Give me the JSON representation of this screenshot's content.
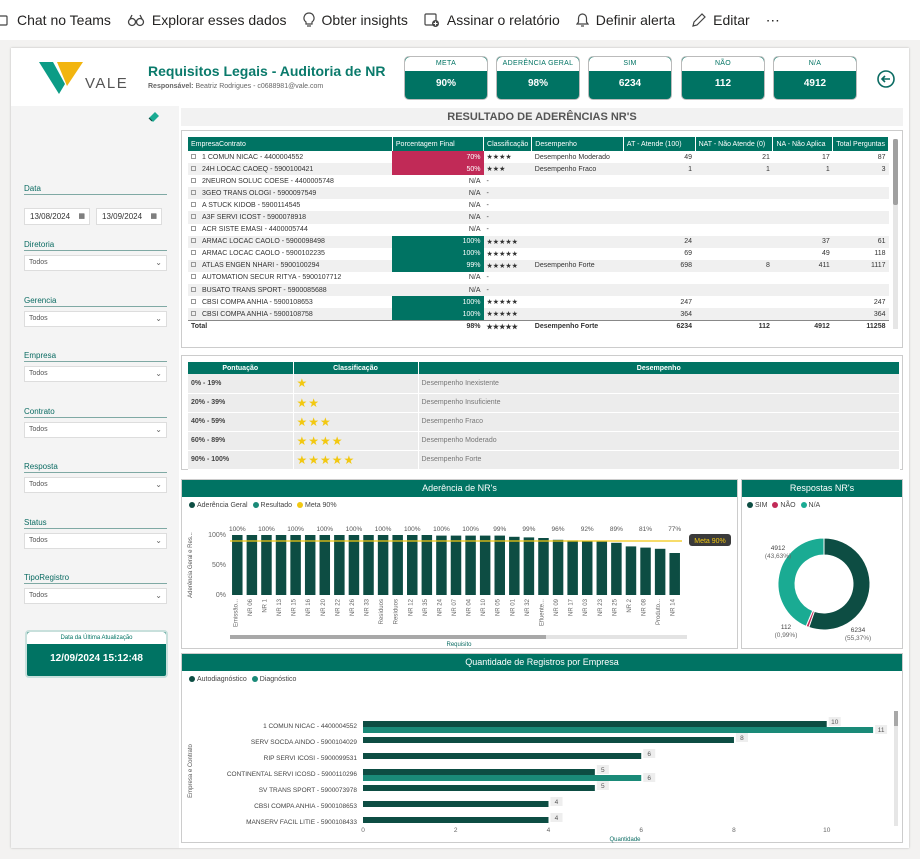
{
  "toolbar": {
    "chat_teams": "Chat no Teams",
    "explore": "Explorar esses dados",
    "insights": "Obter insights",
    "subscribe": "Assinar o relatório",
    "alert": "Definir alerta",
    "edit": "Editar",
    "more": "⋯"
  },
  "header": {
    "logo_text": "VALE",
    "title": "Requisitos Legais - Auditoria de NR",
    "responsible_label": "Responsável:",
    "responsible_value": "Beatriz Rodrigues - c0688981@vale.com"
  },
  "kpis": [
    {
      "label": "META",
      "value": "90%"
    },
    {
      "label": "ADERÊNCIA GERAL",
      "value": "98%"
    },
    {
      "label": "SIM",
      "value": "6234"
    },
    {
      "label": "NÃO",
      "value": "112"
    },
    {
      "label": "N/A",
      "value": "4912"
    }
  ],
  "filters": {
    "data_label": "Data",
    "date_from": "13/08/2024",
    "date_to": "13/09/2024",
    "items": [
      {
        "label": "Diretoria",
        "value": "Todos"
      },
      {
        "label": "Gerencia",
        "value": "Todos"
      },
      {
        "label": "Empresa",
        "value": "Todos"
      },
      {
        "label": "Contrato",
        "value": "Todos"
      },
      {
        "label": "Resposta",
        "value": "Todos"
      },
      {
        "label": "Status",
        "value": "Todos"
      },
      {
        "label": "TipoRegistro",
        "value": "Todos"
      }
    ],
    "update_label": "Data da Última Atualização",
    "update_value": "12/09/2024 15:12:48"
  },
  "section_title": "RESULTADO DE ADERÊNCIAS NR'S",
  "main_table": {
    "headers": [
      "EmpresaContrato",
      "Porcentagem Final",
      "Classificação",
      "Desempenho",
      "AT - Atende (100)",
      "NAT - Não Atende (0)",
      "NA - Não Aplica",
      "Total Perguntas"
    ],
    "rows": [
      {
        "name": "1 COMUN NICAC - 4400004552",
        "pct": "70%",
        "pct_color": "red",
        "stars": "★★★★",
        "desemp": "Desempenho Moderado",
        "at": "49",
        "nat": "21",
        "na": "17",
        "total": "87"
      },
      {
        "name": "24H LOCAC CAOEQ - 5900100421",
        "pct": "50%",
        "pct_color": "red",
        "stars": "★★★",
        "desemp": "Desempenho Fraco",
        "at": "1",
        "nat": "1",
        "na": "1",
        "total": "3"
      },
      {
        "name": "2NEURON SOLUC COESE - 4400005748",
        "pct": "N/A",
        "pct_color": "",
        "stars": "-",
        "desemp": "",
        "at": "",
        "nat": "",
        "na": "",
        "total": ""
      },
      {
        "name": "3GEO TRANS OLOGI - 5900097549",
        "pct": "N/A",
        "pct_color": "",
        "stars": "-",
        "desemp": "",
        "at": "",
        "nat": "",
        "na": "",
        "total": ""
      },
      {
        "name": "A STUCK KIDOB - 5900114545",
        "pct": "N/A",
        "pct_color": "",
        "stars": "-",
        "desemp": "",
        "at": "",
        "nat": "",
        "na": "",
        "total": ""
      },
      {
        "name": "A3F SERVI ICOST - 5900078918",
        "pct": "N/A",
        "pct_color": "",
        "stars": "-",
        "desemp": "",
        "at": "",
        "nat": "",
        "na": "",
        "total": ""
      },
      {
        "name": "ACR SISTE EMASI - 4400005744",
        "pct": "N/A",
        "pct_color": "",
        "stars": "-",
        "desemp": "",
        "at": "",
        "nat": "",
        "na": "",
        "total": ""
      },
      {
        "name": "ARMAC LOCAC CAOLO - 5900098498",
        "pct": "100%",
        "pct_color": "grn",
        "stars": "★★★★★",
        "desemp": "",
        "at": "24",
        "nat": "",
        "na": "37",
        "total": "61"
      },
      {
        "name": "ARMAC LOCAC CAOLO - 5900102235",
        "pct": "100%",
        "pct_color": "grn",
        "stars": "★★★★★",
        "desemp": "",
        "at": "69",
        "nat": "",
        "na": "49",
        "total": "118"
      },
      {
        "name": "ATLAS ENGEN NHARI - 5900100294",
        "pct": "99%",
        "pct_color": "grn",
        "stars": "★★★★★",
        "desemp": "Desempenho Forte",
        "at": "698",
        "nat": "8",
        "na": "411",
        "total": "1117"
      },
      {
        "name": "AUTOMATION SECUR RITYA - 5900107712",
        "pct": "N/A",
        "pct_color": "",
        "stars": "-",
        "desemp": "",
        "at": "",
        "nat": "",
        "na": "",
        "total": ""
      },
      {
        "name": "BUSATO TRANS SPORT - 5900085688",
        "pct": "N/A",
        "pct_color": "",
        "stars": "-",
        "desemp": "",
        "at": "",
        "nat": "",
        "na": "",
        "total": ""
      },
      {
        "name": "CBSI COMPA ANHIA - 5900108653",
        "pct": "100%",
        "pct_color": "grn",
        "stars": "★★★★★",
        "desemp": "",
        "at": "247",
        "nat": "",
        "na": "",
        "total": "247"
      },
      {
        "name": "CBSI COMPA ANHIA - 5900108758",
        "pct": "100%",
        "pct_color": "grn",
        "stars": "★★★★★",
        "desemp": "",
        "at": "364",
        "nat": "",
        "na": "",
        "total": "364"
      }
    ],
    "total": {
      "name": "Total",
      "pct": "98%",
      "stars": "★★★★★",
      "desemp": "Desempenho Forte",
      "at": "6234",
      "nat": "112",
      "na": "4912",
      "total": "11258"
    }
  },
  "legend_table": {
    "headers": [
      "Pontuação",
      "Classificação",
      "Desempenho"
    ],
    "rows": [
      {
        "range": "0% - 19%",
        "stars": "★",
        "desc": "Desempenho Inexistente"
      },
      {
        "range": "20% - 39%",
        "stars": "★★",
        "desc": "Desempenho Insuficiente"
      },
      {
        "range": "40% - 59%",
        "stars": "★★★",
        "desc": "Desempenho Fraco"
      },
      {
        "range": "60% - 89%",
        "stars": "★★★★",
        "desc": "Desempenho Moderado"
      },
      {
        "range": "90% - 100%",
        "stars": "★★★★★",
        "desc": "Desempenho Forte"
      }
    ]
  },
  "colors": {
    "primary": "#007363",
    "dark": "#0d4d43",
    "mid": "#1aab93",
    "red": "#c12a57",
    "gold": "#f2c811"
  },
  "chart_data": [
    {
      "type": "bar",
      "title": "Aderência de NR's",
      "xlabel": "Requisito",
      "ylabel": "Aderência Geral e Res...",
      "ylim": [
        0,
        100
      ],
      "yticks": [
        "0%",
        "50%",
        "100%"
      ],
      "legend": [
        "Aderência Geral",
        "Resultado",
        "Meta 90%"
      ],
      "meta_label": "Meta 90%",
      "meta": 90,
      "categories": [
        "Emissão...",
        "NR 06",
        "NR 1",
        "NR 13",
        "NR 15",
        "NR 16",
        "NR 20",
        "NR 22",
        "NR 26",
        "NR 33",
        "Resíduos",
        "Resíduos",
        "NR 12",
        "NR 35",
        "NR 24",
        "NR 07",
        "NR 04",
        "NR 10",
        "NR 05",
        "NR 01",
        "NR 32",
        "Efluente...",
        "NR 09",
        "NR 17",
        "NR 03",
        "NR 23",
        "NR 25",
        "NR 2",
        "NR 08",
        "Produto...",
        "NR 14"
      ],
      "values": [
        100,
        100,
        100,
        100,
        100,
        100,
        100,
        100,
        100,
        100,
        100,
        100,
        100,
        100,
        99,
        99,
        99,
        99,
        99,
        97,
        96,
        95,
        92,
        91,
        90,
        89,
        87,
        81,
        79,
        77,
        70
      ],
      "labels": [
        "100%",
        "100%",
        "100%",
        "100%",
        "100%",
        "100%",
        "100%",
        "100%",
        "100%",
        "100%",
        "100%",
        "100%",
        "100%",
        "100%",
        "99%",
        "99%",
        "99%",
        "99%",
        "96%",
        "92%",
        "89%",
        "81%",
        "77%"
      ]
    },
    {
      "type": "pie",
      "title": "Respostas NR's",
      "legend": [
        "SIM",
        "NÃO",
        "N/A"
      ],
      "values": [
        6234,
        112,
        4912
      ],
      "percent": [
        "55,37%",
        "0,99%",
        "43,63%"
      ]
    },
    {
      "type": "bar",
      "title": "Quantidade de Registros por Empresa",
      "xlabel": "Quantidade",
      "ylabel": "Empresa e Contrato",
      "legend": [
        "Autodiagnóstico",
        "Diagnóstico"
      ],
      "categories": [
        "1 COMUN NICAC - 4400004552",
        "SERV SOCDA AINDO - 5900104029",
        "RIP SERVI ICOSI - 5900099531",
        "CONTINENTAL SERVI ICOSD - 5900110296",
        "SV TRANS SPORT - 5900073978",
        "CBSI COMPA ANHIA - 5900108653",
        "MANSERV FACIL LITIE - 5900108433"
      ],
      "series": [
        {
          "name": "Autodiagnóstico",
          "values": [
            10,
            8,
            6,
            5,
            5,
            4,
            4
          ]
        },
        {
          "name": "Diagnóstico",
          "values": [
            11,
            null,
            null,
            6,
            null,
            null,
            null
          ]
        }
      ],
      "xticks": [
        "0",
        "2",
        "4",
        "6",
        "8",
        "10"
      ],
      "xlim": [
        0,
        11.3
      ]
    }
  ]
}
